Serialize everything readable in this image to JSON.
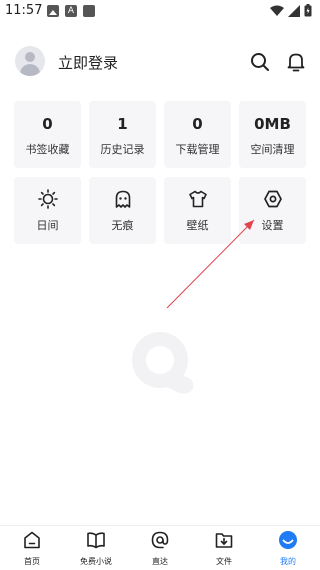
{
  "status": {
    "time": "11:57"
  },
  "header": {
    "login_label": "立即登录"
  },
  "stats": [
    {
      "value": "0",
      "label": "书签收藏"
    },
    {
      "value": "1",
      "label": "历史记录"
    },
    {
      "value": "0",
      "label": "下载管理"
    },
    {
      "value": "0MB",
      "label": "空间清理"
    }
  ],
  "tools": [
    {
      "label": "日间",
      "icon": "sun-icon"
    },
    {
      "label": "无痕",
      "icon": "ghost-icon"
    },
    {
      "label": "壁纸",
      "icon": "shirt-icon"
    },
    {
      "label": "设置",
      "icon": "settings-hexagon-icon"
    }
  ],
  "tabs": [
    {
      "label": "首页",
      "icon": "home-icon"
    },
    {
      "label": "免费小说",
      "icon": "book-icon"
    },
    {
      "label": "直达",
      "icon": "at-icon"
    },
    {
      "label": "文件",
      "icon": "download-folder-icon"
    },
    {
      "label": "我的",
      "icon": "profile-face-icon",
      "active": true
    }
  ],
  "colors": {
    "accent": "#1f7cf5",
    "arrow": "#e0444f",
    "card_bg": "#f6f6f8"
  }
}
